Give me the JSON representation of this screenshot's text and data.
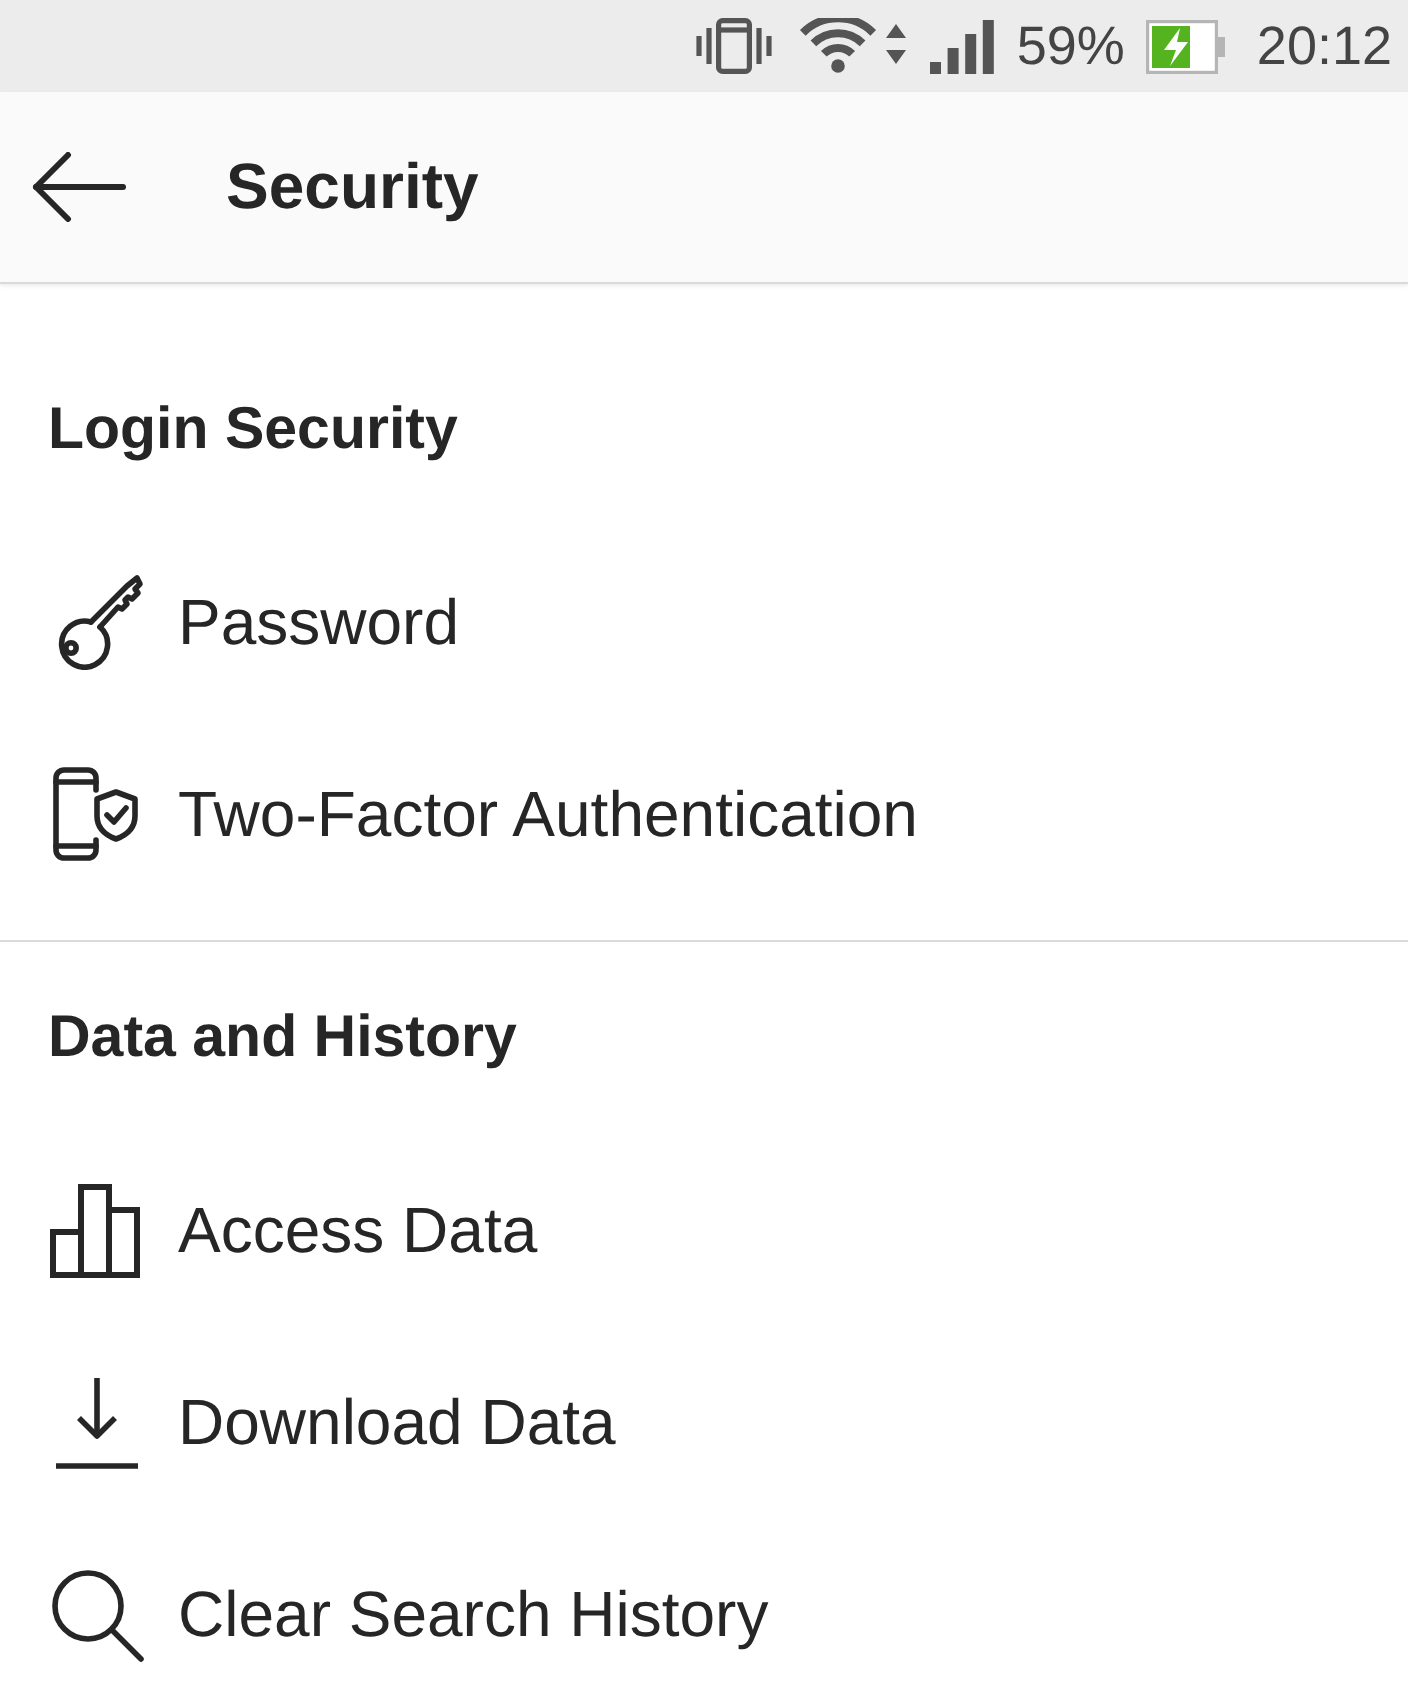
{
  "status_bar": {
    "battery_percent": "59%",
    "time": "20:12"
  },
  "header": {
    "title": "Security"
  },
  "sections": [
    {
      "title": "Login Security",
      "items": [
        {
          "label": "Password"
        },
        {
          "label": "Two-Factor Authentication"
        }
      ]
    },
    {
      "title": "Data and History",
      "items": [
        {
          "label": "Access Data"
        },
        {
          "label": "Download Data"
        },
        {
          "label": "Clear Search History"
        }
      ]
    }
  ]
}
